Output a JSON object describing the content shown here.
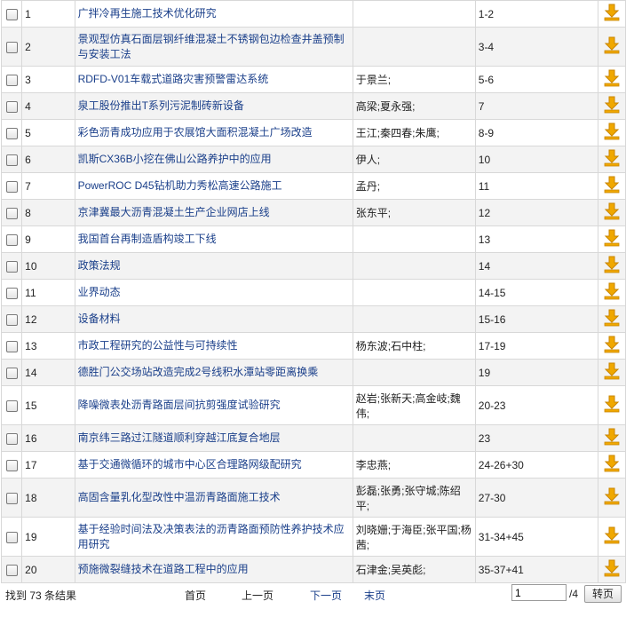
{
  "results": [
    {
      "num": "1",
      "title": "广拌冷再生施工技术优化研究",
      "authors": "",
      "pages": "1-2"
    },
    {
      "num": "2",
      "title": "景观型仿真石面层钢纤维混凝土不锈钢包边检查井盖预制与安装工法",
      "authors": "",
      "pages": "3-4"
    },
    {
      "num": "3",
      "title": "RDFD-V01车载式道路灾害预警雷达系统",
      "authors": "于景兰;",
      "pages": "5-6"
    },
    {
      "num": "4",
      "title": "泉工股份推出T系列污泥制砖新设备",
      "authors": "高梁;夏永强;",
      "pages": "7"
    },
    {
      "num": "5",
      "title": "彩色沥青成功应用于农展馆大面积混凝土广场改造",
      "authors": "王江;秦四春;朱鹰;",
      "pages": "8-9"
    },
    {
      "num": "6",
      "title": "凯斯CX36B小挖在佛山公路养护中的应用",
      "authors": "伊人;",
      "pages": "10"
    },
    {
      "num": "7",
      "title": "PowerROC D45钻机助力秀松高速公路施工",
      "authors": "孟丹;",
      "pages": "11"
    },
    {
      "num": "8",
      "title": "京津冀最大沥青混凝土生产企业网店上线",
      "authors": "张东平;",
      "pages": "12"
    },
    {
      "num": "9",
      "title": "我国首台再制造盾构竣工下线",
      "authors": "",
      "pages": "13"
    },
    {
      "num": "10",
      "title": "政策法规",
      "authors": "",
      "pages": "14"
    },
    {
      "num": "11",
      "title": "业界动态",
      "authors": "",
      "pages": "14-15"
    },
    {
      "num": "12",
      "title": "设备材料",
      "authors": "",
      "pages": "15-16"
    },
    {
      "num": "13",
      "title": "市政工程研究的公益性与可持续性",
      "authors": "杨东波;石中柱;",
      "pages": "17-19"
    },
    {
      "num": "14",
      "title": "德胜门公交场站改造完成2号线积水潭站零距离换乘",
      "authors": "",
      "pages": "19"
    },
    {
      "num": "15",
      "title": "降噪微表处沥青路面层间抗剪强度试验研究",
      "authors": "赵岩;张新天;高金岐;魏伟;",
      "pages": "20-23"
    },
    {
      "num": "16",
      "title": "南京纬三路过江隧道顺利穿越江底复合地层",
      "authors": "",
      "pages": "23"
    },
    {
      "num": "17",
      "title": "基于交通微循环的城市中心区合理路网级配研究",
      "authors": "李忠燕;",
      "pages": "24-26+30"
    },
    {
      "num": "18",
      "title": "高固含量乳化型改性中温沥青路面施工技术",
      "authors": "彭磊;张勇;张守城;陈绍平;",
      "pages": "27-30"
    },
    {
      "num": "19",
      "title": "基于经验时间法及决策表法的沥青路面预防性养护技术应用研究",
      "authors": "刘晓姗;于海臣;张平国;杨茜;",
      "pages": "31-34+45"
    },
    {
      "num": "20",
      "title": "预施微裂缝技术在道路工程中的应用",
      "authors": "石津金;吴英彪;",
      "pages": "35-37+41"
    }
  ],
  "footer": {
    "result_count": "找到 73 条结果",
    "first": "首页",
    "prev": "上一页",
    "next": "下一页",
    "last": "末页",
    "page_value": "1",
    "total_pages": "/4",
    "go_button": "转页"
  },
  "colors": {
    "link": "#1a3f8a",
    "download_icon": "#f0a800",
    "row_alt": "#f3f3f3",
    "border": "#d8d8d8"
  }
}
